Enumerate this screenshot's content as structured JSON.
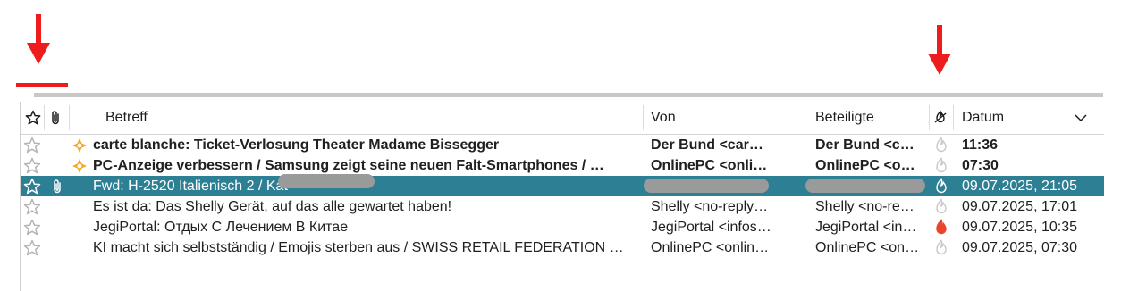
{
  "annotation": {
    "arrow_color": "#ee1c1c"
  },
  "colors": {
    "selected_row": "#2d7f93",
    "unread_spark": "#f5a623",
    "junk_hot": "#e8472c",
    "junk_cold": "#c8c8c8"
  },
  "header": {
    "star_icon": "star-outline-icon",
    "attachment_icon": "paperclip-icon",
    "subject_label": "Betreff",
    "from_label": "Von",
    "participants_label": "Beteiligte",
    "junk_icon": "junk-status-icon",
    "date_label": "Datum",
    "sort_icon": "chevron-down-icon"
  },
  "messages": [
    {
      "subject": "carte blanche: Ticket-Verlosung Theater Madame Bissegger",
      "from": "Der Bund <car…",
      "participants": "Der Bund <c…",
      "date": "11:36",
      "unread": true,
      "selected": false,
      "attachment": false,
      "junk": "cold"
    },
    {
      "subject": "PC-Anzeige verbessern / Samsung zeigt seine neuen Falt-Smartphones / …",
      "from": "OnlinePC <onli…",
      "participants": "OnlinePC <o…",
      "date": "07:30",
      "unread": true,
      "selected": false,
      "attachment": false,
      "junk": "cold"
    },
    {
      "subject": "Fwd: H-2520 Italienisch 2 / Kat",
      "from": "",
      "participants": "",
      "date": "09.07.2025, 21:05",
      "unread": false,
      "selected": true,
      "attachment": true,
      "junk": "cold"
    },
    {
      "subject": "Es ist da: Das Shelly Gerät, auf das alle gewartet haben!",
      "from": "Shelly <no-reply…",
      "participants": "Shelly <no-re…",
      "date": "09.07.2025, 17:01",
      "unread": false,
      "selected": false,
      "attachment": false,
      "junk": "cold"
    },
    {
      "subject": "JegiPortal: Отдых С Лечением В Китае",
      "from": "JegiPortal <infos…",
      "participants": "JegiPortal <in…",
      "date": "09.07.2025, 10:35",
      "unread": false,
      "selected": false,
      "attachment": false,
      "junk": "hot"
    },
    {
      "subject": "KI macht sich selbstständig / Emojis sterben aus / SWISS RETAIL FEDERATION …",
      "from": "OnlinePC <onlin…",
      "participants": "OnlinePC <on…",
      "date": "09.07.2025, 07:30",
      "unread": false,
      "selected": false,
      "attachment": false,
      "junk": "cold"
    }
  ]
}
